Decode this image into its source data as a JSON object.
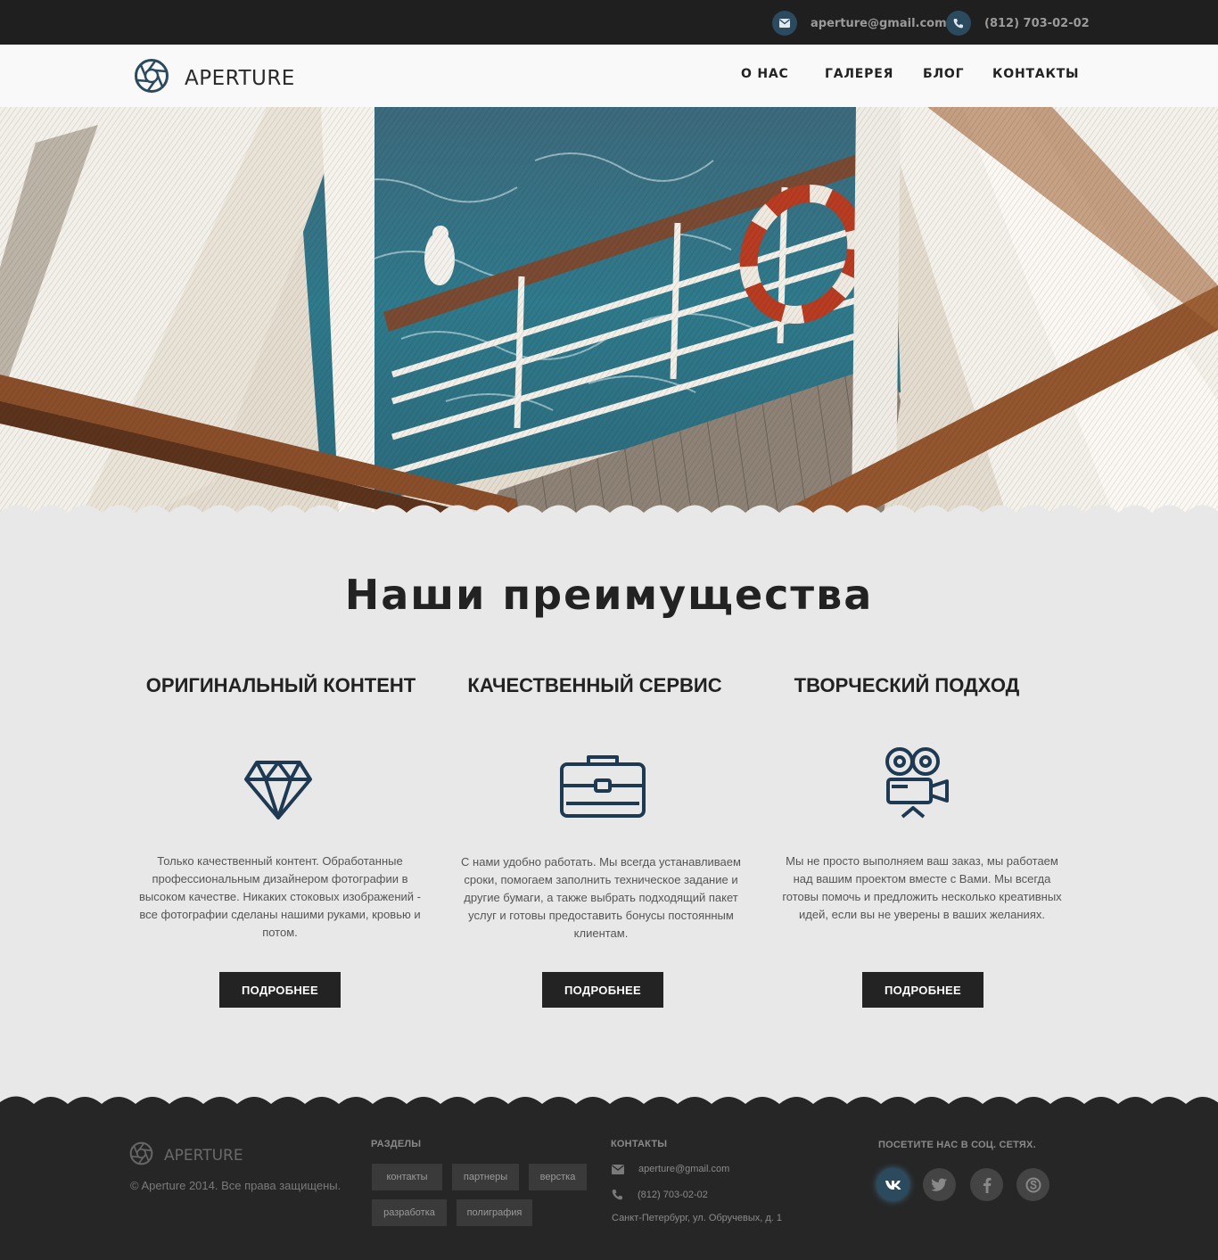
{
  "topbar": {
    "email": "aperture@gmail.com",
    "phone": "(812) 703-02-02",
    "email_icon": "envelope-icon",
    "phone_icon": "phone-icon"
  },
  "header": {
    "logo_text": "APERTURE",
    "logo_icon": "aperture-icon",
    "nav": [
      "О НАС",
      "ГАЛЕРЕЯ",
      "БЛОГ",
      "КОНТАКТЫ"
    ]
  },
  "features": {
    "title": "Наши преимущества",
    "items": [
      {
        "title": "ОРИГИНАЛЬНЫЙ КОНТЕНТ",
        "icon": "diamond-icon",
        "text": "Только качественный контент. Обработанные профессиональным дизайнером фотографии в высоком качестве. Никаких стоковых изображений - все фотографии сделаны нашими руками, кровью и потом.",
        "button": "ПОДРОБНЕЕ"
      },
      {
        "title": "КАЧЕСТВЕННЫЙ СЕРВИС",
        "icon": "briefcase-icon",
        "text": "С нами удобно работать. Мы всегда устанавливаем сроки, помогаем заполнить техническое задание и другие бумаги, а также выбрать подходящий пакет услуг и готовы предоставить бонусы постоянным клиентам.",
        "button": "ПОДРОБНЕЕ"
      },
      {
        "title": "ТВОРЧЕСКИЙ ПОДХОД",
        "icon": "movie-camera-icon",
        "text": "Мы не просто выполняем ваш заказ, мы работаем над вашим проектом вместе с Вами. Мы всегда готовы помочь и предложить несколько креативных идей, если вы не уверены в ваших желаниях.",
        "button": "ПОДРОБНЕЕ"
      }
    ]
  },
  "footer": {
    "logo_text": "APERTURE",
    "copyright": "© Aperture 2014. Все права защищены.",
    "sections_title": "РАЗДЕЛЫ",
    "tags": [
      "контакты",
      "партнеры",
      "верстка",
      "разработка",
      "полиграфия"
    ],
    "contacts_title": "КОНТАКТЫ",
    "email": "aperture@gmail.com",
    "phone": "(812) 703-02-02",
    "address": "Санкт-Петербург, ул. Обручевых, д. 1",
    "social_title": "ПОСЕТИТЕ НАС В СОЦ. СЕТЯХ.",
    "social": [
      "vk-icon",
      "twitter-icon",
      "facebook-icon",
      "skype-icon"
    ]
  },
  "colors": {
    "accent": "#2b4a5e",
    "icon": "#1e3a52",
    "dark": "#232323",
    "background": "#e8e8e8"
  }
}
